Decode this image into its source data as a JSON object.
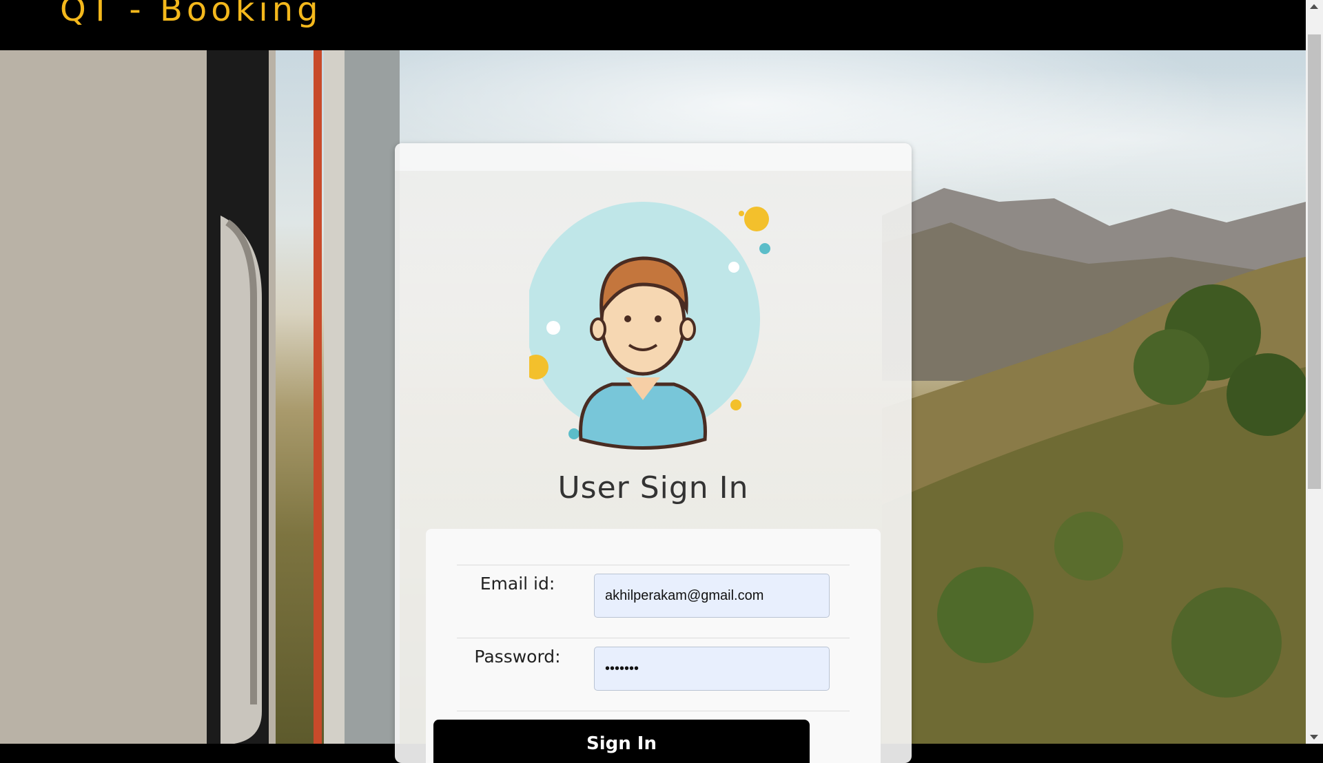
{
  "header": {
    "brand": "QT - Booking"
  },
  "card": {
    "title": "User Sign In",
    "form": {
      "email_label": "Email id:",
      "email_value": "akhilperakam@gmail.com",
      "password_label": "Password:",
      "password_value": "•••••••",
      "submit_label": "Sign In"
    }
  },
  "colors": {
    "brand": "#f4b81c",
    "input_bg": "#e8effd",
    "button_bg": "#000000",
    "avatar_circle": "#bfe6e8"
  },
  "icons": [
    "user-avatar-illustration"
  ]
}
